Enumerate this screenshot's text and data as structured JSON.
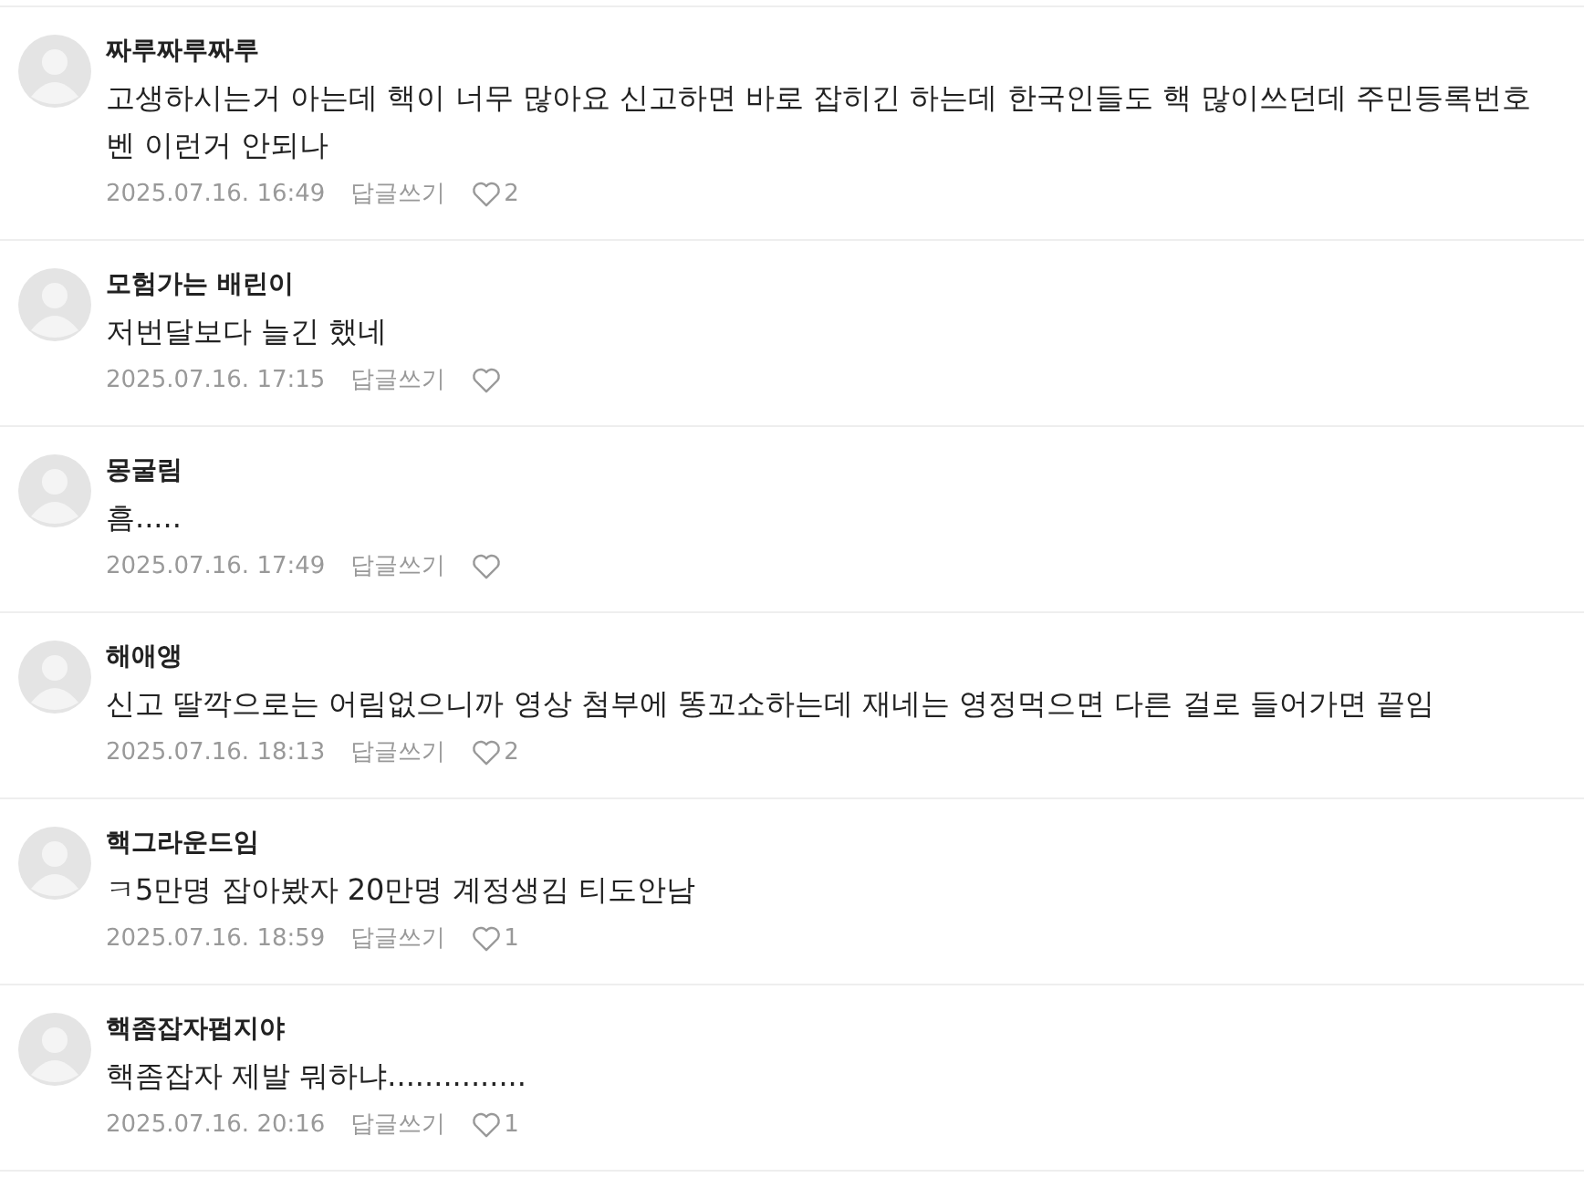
{
  "comments": [
    {
      "author": "짜루짜루짜루",
      "text": "고생하시는거 아는데 핵이 너무 많아요 신고하면 바로 잡히긴 하는데 한국인들도 핵 많이쓰던데 주민등록번호 벤 이런거 안되나",
      "date": "2025.07.16. 16:49",
      "reply": "답글쓰기",
      "likes": "2"
    },
    {
      "author": "모험가는 배린이",
      "text": "저번달보다 늘긴 했네",
      "date": "2025.07.16. 17:15",
      "reply": "답글쓰기"
    },
    {
      "author": "몽굴림",
      "text": "흠.....",
      "date": "2025.07.16. 17:49",
      "reply": "답글쓰기"
    },
    {
      "author": "해애앵",
      "text": "신고 딸깍으로는 어림없으니까 영상 첨부에 똥꼬쇼하는데 재네는 영정먹으면 다른 걸로 들어가면 끝임",
      "date": "2025.07.16. 18:13",
      "reply": "답글쓰기",
      "likes": "2"
    },
    {
      "author": "핵그라운드임",
      "text": "ㅋ5만명 잡아봤자 20만명 계정생김 티도안남",
      "date": "2025.07.16. 18:59",
      "reply": "답글쓰기",
      "likes": "1"
    },
    {
      "author": "핵좀잡자펍지야",
      "text": "핵좀잡자 제발 뭐하냐...............",
      "date": "2025.07.16. 20:16",
      "reply": "답글쓰기",
      "likes": "1"
    }
  ]
}
